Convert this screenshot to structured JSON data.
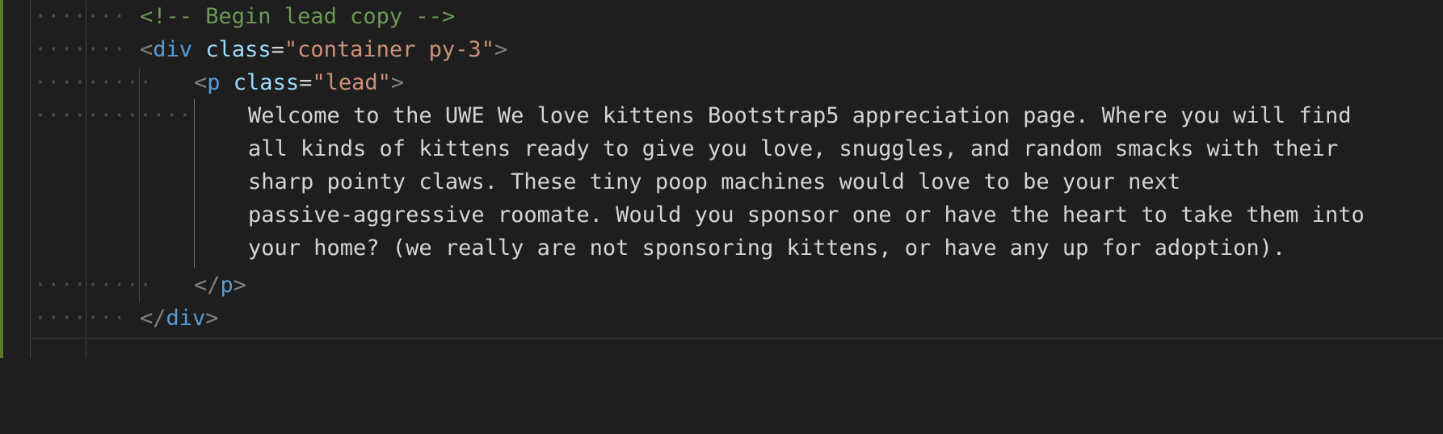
{
  "editor": {
    "colors": {
      "background": "#1e1e1e",
      "comment": "#6a9955",
      "tag": "#569cd6",
      "attribute": "#9cdcfe",
      "string": "#ce9178",
      "punctuation": "#808080",
      "text": "#d4d4d4",
      "gutter_marker": "#5d7a2a"
    },
    "lines": {
      "l1": {
        "comment": "<!-- Begin lead copy -->"
      },
      "l2": {
        "open": "<",
        "tag": "div",
        "attr": "class",
        "eq": "=",
        "value": "\"container py-3\"",
        "close": ">"
      },
      "l3": {
        "open": "<",
        "tag": "p",
        "attr": "class",
        "eq": "=",
        "value": "\"lead\"",
        "close": ">"
      },
      "l4": {
        "text": "Welcome to the UWE We love kittens Bootstrap5 appreciation page. Where you will find"
      },
      "l5": {
        "text": "all kinds of kittens ready to give you love, snuggles, and random smacks with their"
      },
      "l6": {
        "text": "sharp pointy claws. These tiny poop machines would love to be your next"
      },
      "l7": {
        "text": "passive-aggressive roomate. Would you sponsor one or have the heart to take them into"
      },
      "l8": {
        "text": "your home? (we really are not sponsoring kittens, or have any up for adoption)."
      },
      "l9": {
        "open": "</",
        "tag": "p",
        "close": ">"
      },
      "l10": {
        "open": "</",
        "tag": "div",
        "close": ">"
      }
    }
  }
}
